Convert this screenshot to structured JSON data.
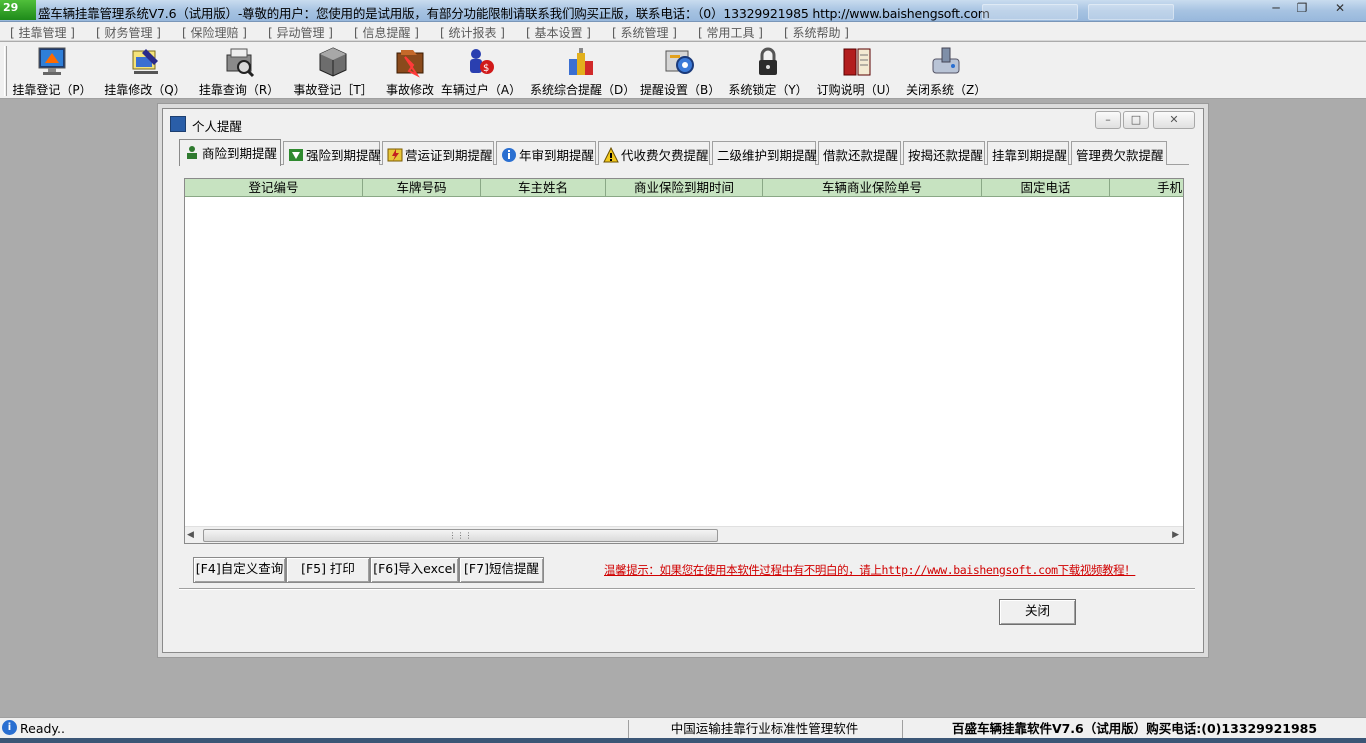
{
  "titlebar": {
    "badge": "29",
    "title": "盛车辆挂靠管理系统V7.6（试用版）-尊敬的用户：您使用的是试用版，有部分功能限制请联系我们购买正版，联系电话：（0）13329921985  http://www.baishengsoft.com"
  },
  "menu": [
    "[ 挂靠管理 ]",
    "[ 财务管理 ]",
    "[ 保险理赔 ]",
    "[ 异动管理 ]",
    "[ 信息提醒 ]",
    "[ 统计报表 ]",
    "[ 基本设置 ]",
    "[ 系统管理 ]",
    "[ 常用工具 ]",
    "[ 系统帮助 ]"
  ],
  "toolbar": [
    {
      "label": "挂靠登记（P）",
      "icon": "monitor-icon"
    },
    {
      "label": "挂靠修改（Q）",
      "icon": "edit-document-icon"
    },
    {
      "label": "挂靠查询（R）",
      "icon": "search-printer-icon"
    },
    {
      "label": "事故登记［T］",
      "icon": "box-icon"
    },
    {
      "label": "事故修改",
      "icon": "broken-folder-icon"
    },
    {
      "label": "车辆过户（A）",
      "icon": "users-transfer-icon"
    },
    {
      "label": "系统综合提醒（D）",
      "icon": "alert-bottles-icon"
    },
    {
      "label": "提醒设置（B）",
      "icon": "settings-gear-icon"
    },
    {
      "label": "系统锁定（Y）",
      "icon": "padlock-icon"
    },
    {
      "label": "订购说明（U）",
      "icon": "book-icon"
    },
    {
      "label": "关闭系统（Z）",
      "icon": "power-off-icon"
    }
  ],
  "window": {
    "title": "个人提醒",
    "tabs": [
      {
        "label": "商险到期提醒",
        "icon": "person-up-icon",
        "active": true
      },
      {
        "label": "强险到期提醒",
        "icon": "green-arrow-icon"
      },
      {
        "label": "营运证到期提醒",
        "icon": "lightning-card-icon"
      },
      {
        "label": "年审到期提醒",
        "icon": "info-circle-icon"
      },
      {
        "label": "代收费欠费提醒",
        "icon": "warning-triangle-icon"
      },
      {
        "label": "二级维护到期提醒"
      },
      {
        "label": "借款还款提醒"
      },
      {
        "label": "按揭还款提醒"
      },
      {
        "label": "挂靠到期提醒"
      },
      {
        "label": "管理费欠款提醒"
      }
    ],
    "columns": [
      "登记编号",
      "车牌号码",
      "车主姓名",
      "商业保险到期时间",
      "车辆商业保险单号",
      "固定电话",
      "手机"
    ],
    "actions": [
      "[F4]自定义查询",
      "[F5] 打印",
      "[F6]导入excel",
      "[F7]短信提醒"
    ],
    "hint": "温馨提示：如果您在使用本软件过程中有不明白的，请上http://www.baishengsoft.com下载视频教程！",
    "close_label": "关闭"
  },
  "status": {
    "ready": "Ready..",
    "center": "中国运输挂靠行业标准性管理软件",
    "right": "百盛车辆挂靠软件V7.6（试用版）购买电话:(0)13329921985"
  },
  "colors": {
    "header_bg": "#c7e3c1",
    "hint_red": "#d00000",
    "mdi_bg": "#ababab"
  }
}
